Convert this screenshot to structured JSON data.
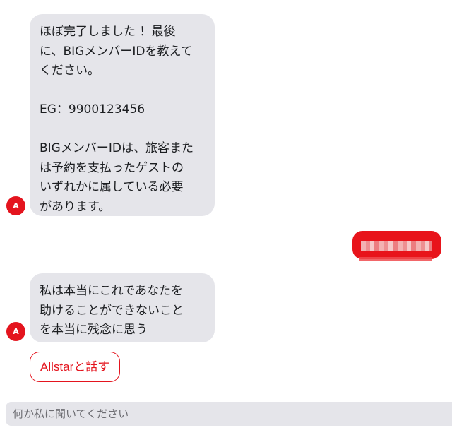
{
  "messages": [
    {
      "sender": "bot",
      "avatar_letter": "A",
      "text": "ほぼ完了しました ！最後\nに、BIGメンバーIDを教えて\nください。\n\nEG：9900123456\n\nBIGメンバーIDは、旅客また\nは予約を支払ったゲストの\nいずれかに属している必要\nがあります。"
    },
    {
      "sender": "bot",
      "avatar_letter": "A",
      "text": "私は本当にこれであなたを\n助けることができないこと\nを本当に残念に思う"
    }
  ],
  "quick_reply": {
    "label": "Allstarと話す"
  },
  "composer": {
    "placeholder": "何か私に聞いてください"
  },
  "colors": {
    "accent": "#e4141e",
    "bot_bubble": "#e5e5ea"
  }
}
